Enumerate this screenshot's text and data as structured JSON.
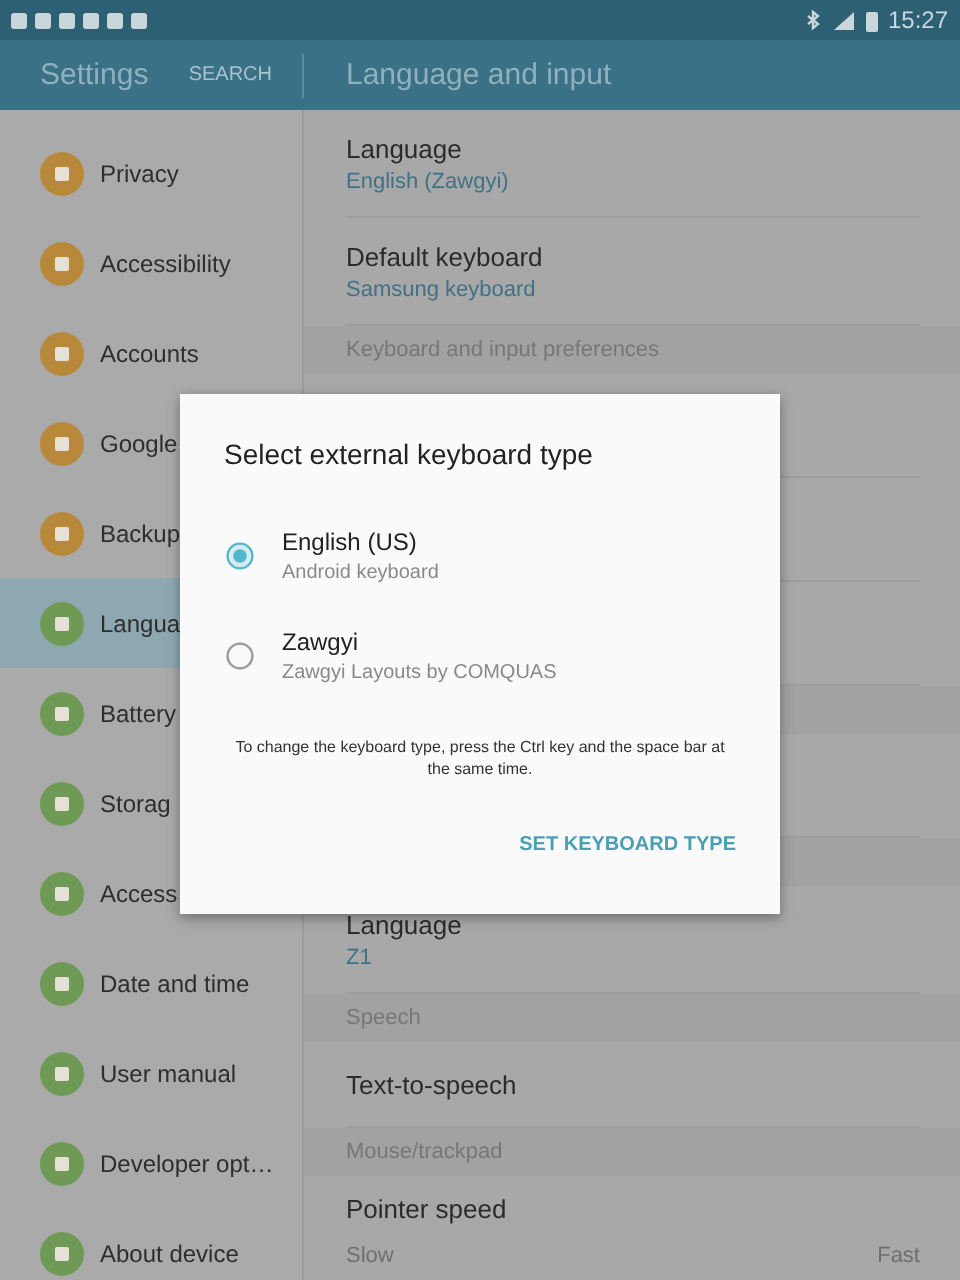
{
  "status_bar": {
    "time": "15:27"
  },
  "app_bar": {
    "title": "Settings",
    "search": "SEARCH",
    "page_title": "Language and input"
  },
  "sidebar": {
    "items": [
      {
        "label": "Privacy",
        "color": "#b8893a",
        "selected": false
      },
      {
        "label": "Accessibility",
        "color": "#b8893a",
        "selected": false
      },
      {
        "label": "Accounts",
        "color": "#b8893a",
        "selected": false
      },
      {
        "label": "Google",
        "color": "#b8893a",
        "selected": false
      },
      {
        "label": "Backup",
        "color": "#b8893a",
        "selected": false
      },
      {
        "label": "Langua",
        "color": "#6f9a55",
        "selected": true
      },
      {
        "label": "Battery",
        "color": "#6f9a55",
        "selected": false
      },
      {
        "label": "Storag",
        "color": "#6f9a55",
        "selected": false
      },
      {
        "label": "Access",
        "color": "#6f9a55",
        "selected": false
      },
      {
        "label": "Date and time",
        "color": "#6f9a55",
        "selected": false
      },
      {
        "label": "User manual",
        "color": "#6f9a55",
        "selected": false
      },
      {
        "label": "Developer opt…",
        "color": "#6f9a55",
        "selected": false
      },
      {
        "label": "About device",
        "color": "#6f9a55",
        "selected": false
      }
    ]
  },
  "content": {
    "rows": [
      {
        "kind": "setting",
        "title": "Language",
        "value": "English (Zawgyi)"
      },
      {
        "kind": "setting",
        "title": "Default keyboard",
        "value": "Samsung keyboard"
      },
      {
        "kind": "header",
        "label": "Keyboard and input preferences"
      },
      {
        "kind": "covered"
      },
      {
        "kind": "covered"
      },
      {
        "kind": "covered"
      },
      {
        "kind": "header"
      },
      {
        "kind": "covered"
      },
      {
        "kind": "header"
      },
      {
        "kind": "setting",
        "title": "Language",
        "value": "Z1"
      },
      {
        "kind": "header",
        "label": "Speech"
      },
      {
        "kind": "setting",
        "title": "Text-to-speech"
      },
      {
        "kind": "header",
        "label": "Mouse/trackpad"
      },
      {
        "kind": "range",
        "title": "Pointer speed",
        "min_label": "Slow",
        "max_label": "Fast"
      }
    ]
  },
  "dialog": {
    "title": "Select external keyboard type",
    "options": [
      {
        "label": "English (US)",
        "sublabel": "Android keyboard",
        "selected": true
      },
      {
        "label": "Zawgyi",
        "sublabel": "Zawgyi Layouts by COMQUAS",
        "selected": false
      }
    ],
    "note": "To change the keyboard type, press the Ctrl key and the space bar at the same time.",
    "button": "SET KEYBOARD TYPE"
  }
}
